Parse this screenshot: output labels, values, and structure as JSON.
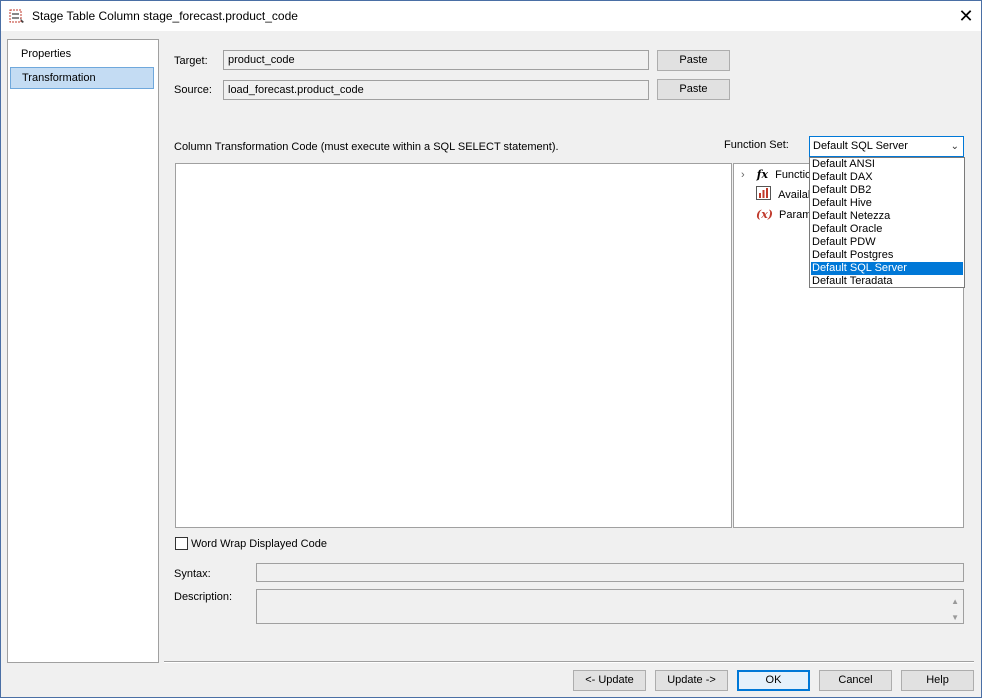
{
  "window": {
    "title": "Stage Table Column stage_forecast.product_code",
    "close_glyph": "✕"
  },
  "nav": {
    "items": [
      {
        "label": "Properties",
        "selected": false
      },
      {
        "label": "Transformation",
        "selected": true
      }
    ]
  },
  "form": {
    "target_label": "Target:",
    "target_value": "product_code",
    "source_label": "Source:",
    "source_value": "load_forecast.product_code",
    "paste_label": "Paste",
    "code_caption": "Column Transformation Code (must execute within a SQL SELECT statement).",
    "function_set_label": "Function Set:",
    "function_set_value": "Default SQL Server",
    "function_set_options": [
      "Default ANSI",
      "Default DAX",
      "Default DB2",
      "Default Hive",
      "Default Netezza",
      "Default Oracle",
      "Default PDW",
      "Default Postgres",
      "Default SQL Server",
      "Default Teradata"
    ],
    "tree_items": [
      {
        "label": "Functio",
        "icon": "function-fx-icon"
      },
      {
        "label": "Availab",
        "icon": "bar-chart-icon"
      },
      {
        "label": "Parame",
        "icon": "parameter-x-icon"
      }
    ],
    "word_wrap_label": "Word Wrap Displayed Code",
    "syntax_label": "Syntax:",
    "description_label": "Description:"
  },
  "footer": {
    "update_prev": "<- Update",
    "update_next": "Update ->",
    "ok": "OK",
    "cancel": "Cancel",
    "help": "Help"
  },
  "colors": {
    "accent": "#0078d7",
    "nav_selected_bg": "#c4dcf3",
    "window_bg": "#f0f0f0"
  }
}
